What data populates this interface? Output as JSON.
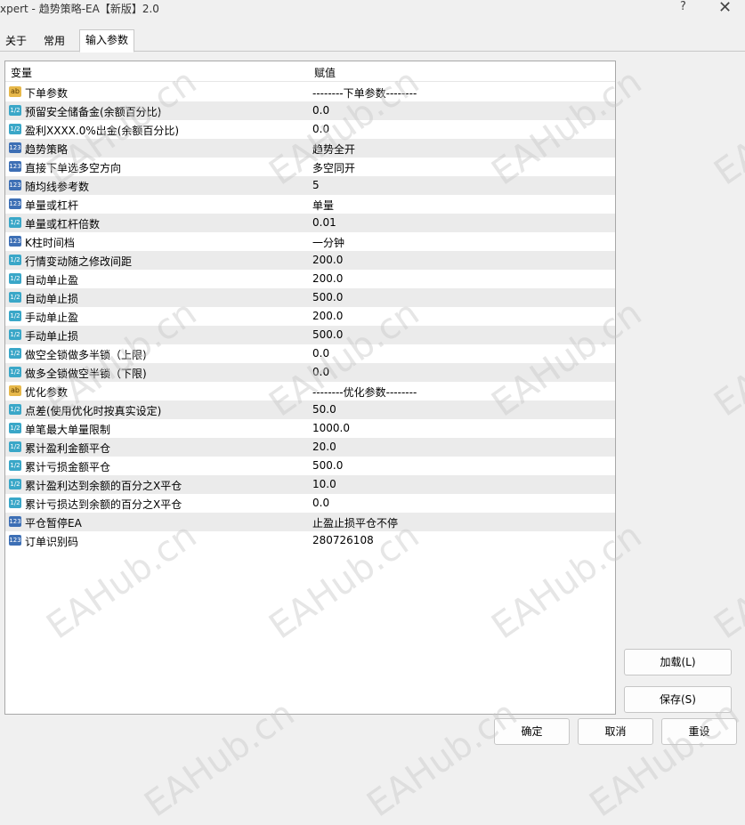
{
  "window": {
    "title": "xpert - 趋势策略-EA【新版】2.0",
    "help_symbol": "?",
    "close_symbol": "✕"
  },
  "tabs": [
    {
      "label": "关于"
    },
    {
      "label": "常用"
    },
    {
      "label": "输入参数"
    }
  ],
  "grid": {
    "col_variable": "变量",
    "col_value": "赋值",
    "rows": [
      {
        "icon": "ab",
        "name": "下单参数",
        "value": "--------下单参数--------"
      },
      {
        "icon": "frac",
        "name": "预留安全储备金(余额百分比)",
        "value": "0.0"
      },
      {
        "icon": "frac",
        "name": "盈利XXXX.0%出金(余额百分比)",
        "value": "0.0"
      },
      {
        "icon": "num",
        "name": "趋势策略",
        "value": "趋势全开"
      },
      {
        "icon": "num",
        "name": "直接下单选多空方向",
        "value": "多空同开"
      },
      {
        "icon": "num",
        "name": "随均线参考数",
        "value": "5"
      },
      {
        "icon": "num",
        "name": "单量或杠杆",
        "value": "单量"
      },
      {
        "icon": "frac",
        "name": "单量或杠杆倍数",
        "value": "0.01"
      },
      {
        "icon": "num",
        "name": "K柱时间档",
        "value": "一分钟"
      },
      {
        "icon": "frac",
        "name": "行情变动随之修改间距",
        "value": "200.0"
      },
      {
        "icon": "frac",
        "name": "自动单止盈",
        "value": "200.0"
      },
      {
        "icon": "frac",
        "name": "自动单止损",
        "value": "500.0"
      },
      {
        "icon": "frac",
        "name": "手动单止盈",
        "value": "200.0"
      },
      {
        "icon": "frac",
        "name": "手动单止损",
        "value": "500.0"
      },
      {
        "icon": "frac",
        "name": "做空全锁做多半锁（上限)",
        "value": "0.0"
      },
      {
        "icon": "frac",
        "name": "做多全锁做空半锁（下限)",
        "value": "0.0"
      },
      {
        "icon": "ab",
        "name": "优化参数",
        "value": "--------优化参数--------"
      },
      {
        "icon": "frac",
        "name": "点差(使用优化时按真实设定)",
        "value": "50.0"
      },
      {
        "icon": "frac",
        "name": "单笔最大单量限制",
        "value": "1000.0"
      },
      {
        "icon": "frac",
        "name": "累计盈利金额平仓",
        "value": "20.0"
      },
      {
        "icon": "frac",
        "name": "累计亏损金额平仓",
        "value": "500.0"
      },
      {
        "icon": "frac",
        "name": "累计盈利达到余额的百分之X平仓",
        "value": "10.0"
      },
      {
        "icon": "frac",
        "name": "累计亏损达到余额的百分之X平仓",
        "value": "0.0"
      },
      {
        "icon": "num",
        "name": "平仓暂停EA",
        "value": "止盈止损平仓不停"
      },
      {
        "icon": "num",
        "name": "订单识别码",
        "value": "280726108"
      }
    ]
  },
  "icon_labels": {
    "ab": "ab",
    "num": "123",
    "frac": "1/2"
  },
  "buttons": {
    "load": "加载(L)",
    "save": "保存(S)",
    "ok": "确定",
    "cancel": "取消",
    "reset": "重设"
  },
  "watermark_text": "EAHub.cn"
}
